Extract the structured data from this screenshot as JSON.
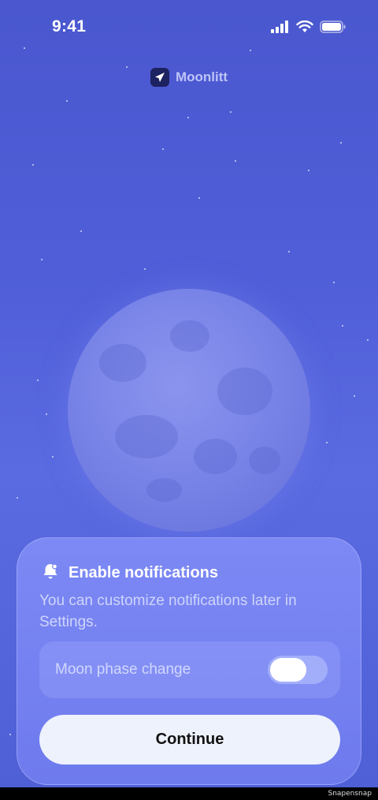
{
  "status_bar": {
    "time": "9:41"
  },
  "brand": {
    "name": "Moonlitt"
  },
  "sheet": {
    "title": "Enable notifications",
    "description": "You can customize notifications later in Settings.",
    "toggle_label": "Moon phase change",
    "toggle_on": true,
    "continue_label": "Continue"
  },
  "footer": {
    "watermark": "Snapensnap"
  },
  "colors": {
    "background": "#5060d8",
    "sheet": "#7a88f0",
    "button": "#eef2fd"
  }
}
